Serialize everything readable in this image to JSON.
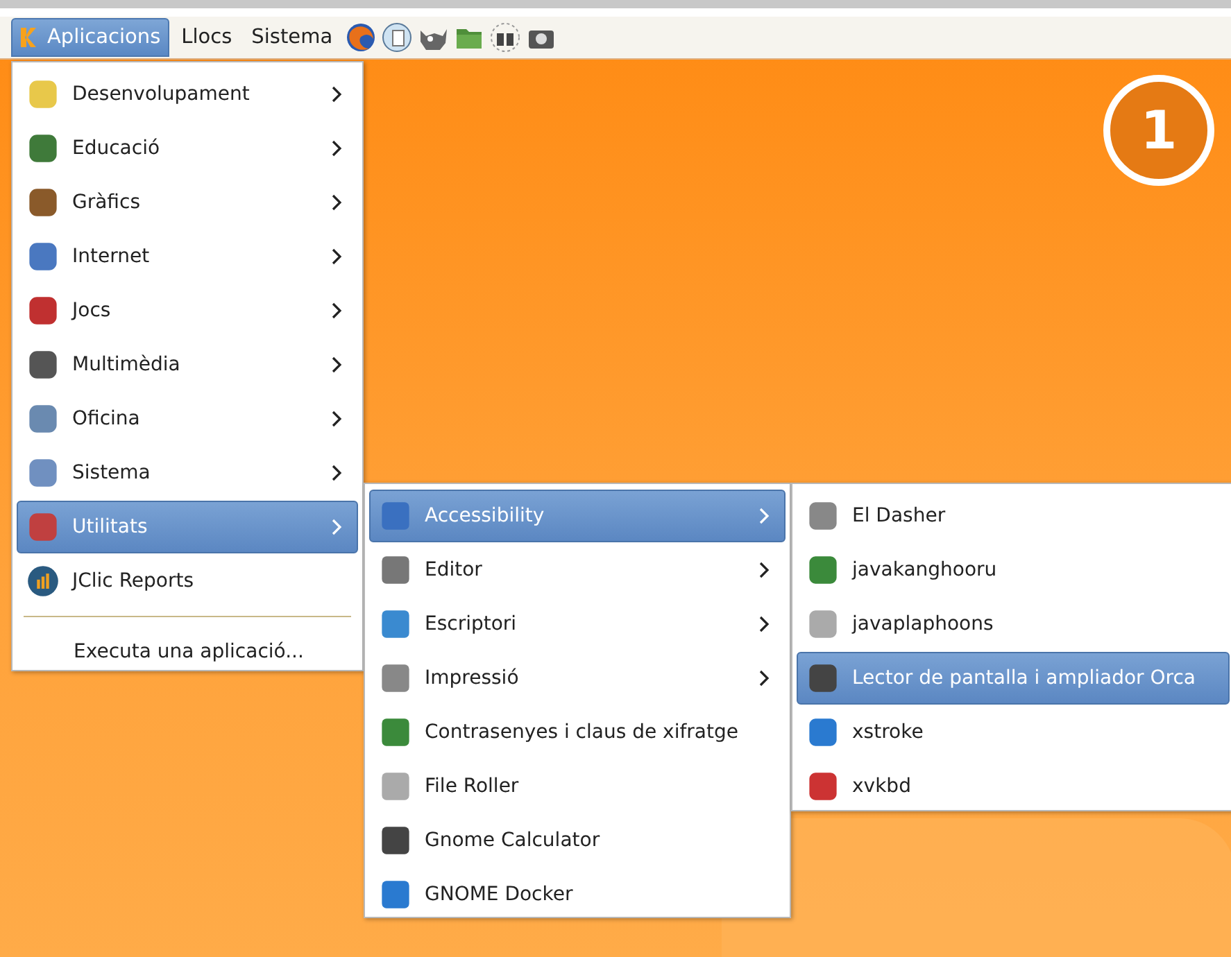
{
  "panel": {
    "menus": [
      {
        "label": "Aplicacions",
        "selected": true
      },
      {
        "label": "Llocs",
        "selected": false
      },
      {
        "label": "Sistema",
        "selected": false
      }
    ]
  },
  "applications_menu": {
    "items": [
      {
        "label": "Desenvolupament",
        "selected": false
      },
      {
        "label": "Educació",
        "selected": false
      },
      {
        "label": "Gràfics",
        "selected": false
      },
      {
        "label": "Internet",
        "selected": false
      },
      {
        "label": "Jocs",
        "selected": false
      },
      {
        "label": "Multimèdia",
        "selected": false
      },
      {
        "label": "Oficina",
        "selected": false
      },
      {
        "label": "Sistema",
        "selected": false
      },
      {
        "label": "Utilitats",
        "selected": true
      }
    ],
    "launchers": [
      "JClic Reports"
    ],
    "run_command": "Executa una aplicació..."
  },
  "utilities_menu": {
    "items": [
      {
        "label": "Accessibility",
        "submenu": true,
        "selected": true
      },
      {
        "label": "Editor",
        "submenu": true,
        "selected": false
      },
      {
        "label": "Escriptori",
        "submenu": true,
        "selected": false
      },
      {
        "label": "Impressió",
        "submenu": true,
        "selected": false
      },
      {
        "label": "Contrasenyes i claus de xifratge",
        "submenu": false,
        "selected": false
      },
      {
        "label": "File Roller",
        "submenu": false,
        "selected": false
      },
      {
        "label": "Gnome Calculator",
        "submenu": false,
        "selected": false
      },
      {
        "label": "GNOME Docker",
        "submenu": false,
        "selected": false
      }
    ]
  },
  "accessibility_menu": {
    "items": [
      {
        "label": "El Dasher",
        "selected": false
      },
      {
        "label": "javakanghooru",
        "selected": false
      },
      {
        "label": "javaplaphoons",
        "selected": false
      },
      {
        "label": "Lector de pantalla i ampliador Orca",
        "selected": true
      },
      {
        "label": "xstroke",
        "selected": false
      },
      {
        "label": "xvkbd",
        "selected": false
      }
    ]
  },
  "step_badge": "1"
}
